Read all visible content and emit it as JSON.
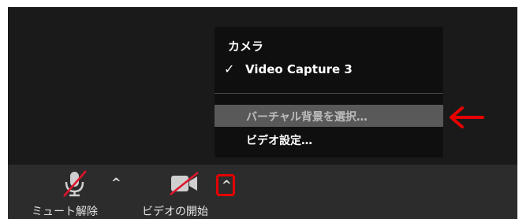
{
  "menu": {
    "header": "カメラ",
    "check_mark": "✓",
    "camera_option": "Video Capture 3",
    "virtual_background": "バーチャル背景を選択…",
    "video_settings": "ビデオ設定…"
  },
  "toolbar": {
    "unmute_label": "ミュート解除",
    "start_video_label": "ビデオの開始",
    "caret": "^"
  },
  "colors": {
    "highlight": "#595959",
    "accent_red": "#e60000",
    "toolbar_bg": "#2c2c2c",
    "menu_bg": "#0f0f0f"
  }
}
